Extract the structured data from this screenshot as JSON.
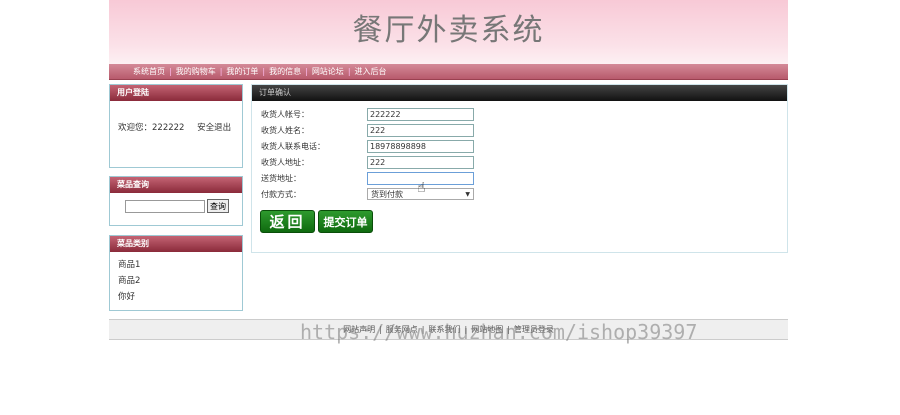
{
  "header": {
    "title": "餐厅外卖系统"
  },
  "nav": {
    "items": [
      "系统首页",
      "我的购物车",
      "我的订单",
      "我的信息",
      "网站论坛",
      "进入后台"
    ]
  },
  "login": {
    "title": "用户登陆",
    "welcome": "欢迎您：222222",
    "logout": "安全退出"
  },
  "search": {
    "title": "菜品查询",
    "input_value": "",
    "button": "查询"
  },
  "categories": {
    "title": "菜品类别",
    "items": [
      "商品1",
      "商品2",
      "你好"
    ]
  },
  "order": {
    "title": "订单确认",
    "fields": [
      {
        "label": "收货人帐号：",
        "value": "222222"
      },
      {
        "label": "收货人姓名：",
        "value": "222"
      },
      {
        "label": "收货人联系电话：",
        "value": "18978898898"
      },
      {
        "label": "收货人地址：",
        "value": "222"
      },
      {
        "label": "送货地址：",
        "value": ""
      }
    ],
    "payment": {
      "label": "付款方式：",
      "selected": "货到付款"
    },
    "back_button": "返回",
    "submit_button": "提交订单"
  },
  "footer": {
    "items": [
      "网站声明",
      "服务网点",
      "联系我们",
      "网站地图",
      "管理员登录"
    ]
  },
  "watermark": "https://www.huzhan.com/ishop39397",
  "colors": {
    "header_pink": "#f8c9d6",
    "nav_bar": "#b85a6c",
    "box_header": "#8a2a3a",
    "main_header": "#111111",
    "button_green": "#1a7f1a"
  }
}
